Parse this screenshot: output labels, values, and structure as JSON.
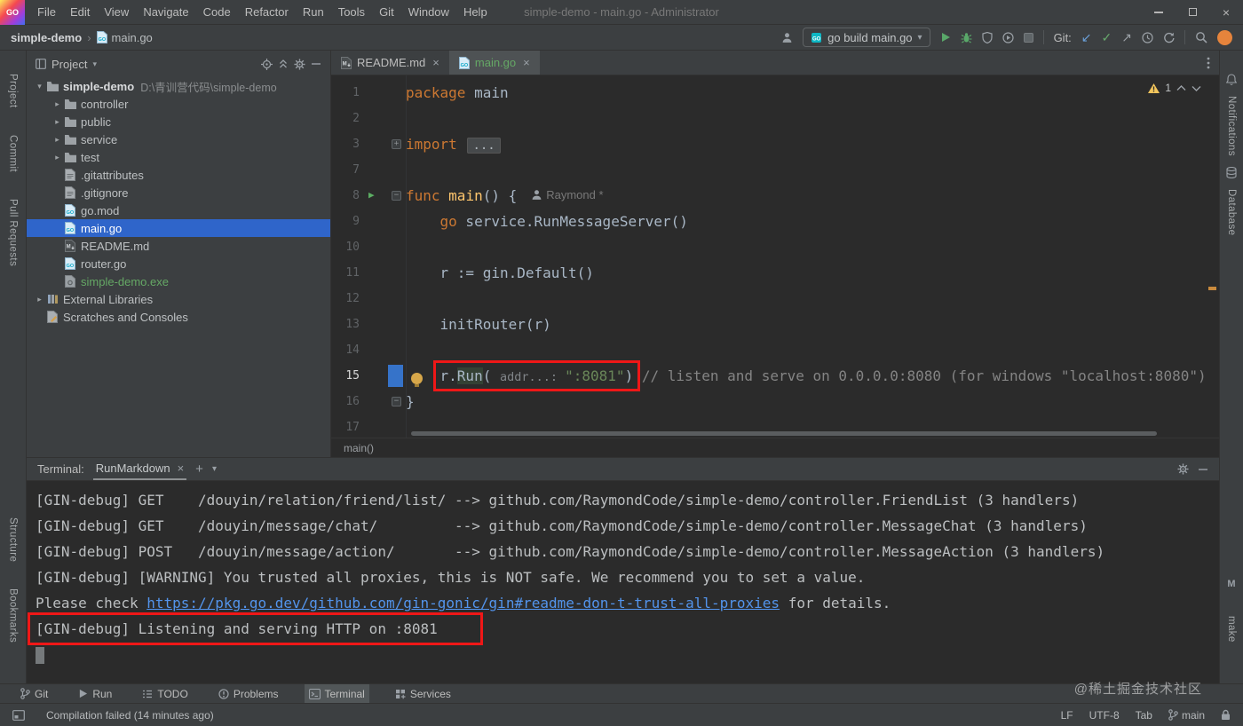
{
  "window": {
    "logo_text": "GO",
    "menus": [
      "File",
      "Edit",
      "View",
      "Navigate",
      "Code",
      "Refactor",
      "Run",
      "Tools",
      "Git",
      "Window",
      "Help"
    ],
    "title": "simple-demo - main.go - Administrator"
  },
  "nav": {
    "breadcrumb_root": "simple-demo",
    "breadcrumb_sep": "›",
    "breadcrumb_file": "main.go",
    "run_config": "go build main.go",
    "git_label": "Git:"
  },
  "stripes": {
    "left_top": [
      "Project",
      "Commit",
      "Pull Requests"
    ],
    "left_bottom": [
      "Structure",
      "Bookmarks"
    ],
    "right_top": [
      "Notifications",
      "Database"
    ],
    "right_bottom": [
      "make"
    ],
    "make_badge": "M"
  },
  "project": {
    "title": "Project",
    "tree": [
      {
        "label": "simple-demo",
        "hint": "D:\\青训营代码\\simple-demo",
        "icon": "folder",
        "indent": 0,
        "arrow": "down",
        "bold": true
      },
      {
        "label": "controller",
        "icon": "folder",
        "indent": 1,
        "arrow": "right"
      },
      {
        "label": "public",
        "icon": "folder",
        "indent": 1,
        "arrow": "right"
      },
      {
        "label": "service",
        "icon": "folder",
        "indent": 1,
        "arrow": "right"
      },
      {
        "label": "test",
        "icon": "folder",
        "indent": 1,
        "arrow": "right"
      },
      {
        "label": ".gitattributes",
        "icon": "file",
        "indent": 1
      },
      {
        "label": ".gitignore",
        "icon": "ignore",
        "indent": 1
      },
      {
        "label": "go.mod",
        "icon": "gomod",
        "indent": 1
      },
      {
        "label": "main.go",
        "icon": "go",
        "indent": 1,
        "selected": true
      },
      {
        "label": "README.md",
        "icon": "md",
        "indent": 1
      },
      {
        "label": "router.go",
        "icon": "go",
        "indent": 1
      },
      {
        "label": "simple-demo.exe",
        "icon": "exe",
        "indent": 1,
        "green": true
      },
      {
        "label": "External Libraries",
        "icon": "lib",
        "indent": 0,
        "arrow": "right"
      },
      {
        "label": "Scratches and Consoles",
        "icon": "scratch",
        "indent": 0
      }
    ]
  },
  "tabs": [
    {
      "label": "README.md",
      "icon": "mdpage",
      "active": false
    },
    {
      "label": "main.go",
      "icon": "gopage",
      "active": true
    }
  ],
  "editor": {
    "inspection_count": "1",
    "breadcrumb": "main()",
    "lines": [
      {
        "num": "1",
        "segs": [
          {
            "t": "package",
            "c": "kw"
          },
          {
            "t": " main",
            "c": "txt"
          }
        ]
      },
      {
        "num": "2",
        "segs": []
      },
      {
        "num": "3",
        "fold": "plus",
        "segs": [
          {
            "t": "import ",
            "c": "kw"
          },
          {
            "t": "...",
            "c": "fold"
          }
        ]
      },
      {
        "num": "7",
        "segs": []
      },
      {
        "num": "8",
        "run": true,
        "fold": "minus",
        "segs": [
          {
            "t": "func ",
            "c": "kw"
          },
          {
            "t": "main",
            "c": "fn"
          },
          {
            "t": "() {",
            "c": "txt"
          },
          {
            "t": "Raymond *",
            "c": "author"
          }
        ]
      },
      {
        "num": "9",
        "segs": [
          {
            "t": "    ",
            "c": "txt"
          },
          {
            "t": "go",
            "c": "kw"
          },
          {
            "t": " service.RunMessageServer()",
            "c": "txt"
          }
        ]
      },
      {
        "num": "10",
        "segs": []
      },
      {
        "num": "11",
        "segs": [
          {
            "t": "    r := gin.Default()",
            "c": "txt"
          }
        ]
      },
      {
        "num": "12",
        "segs": []
      },
      {
        "num": "13",
        "segs": [
          {
            "t": "    initRouter(r)",
            "c": "txt"
          }
        ]
      },
      {
        "num": "14",
        "segs": []
      },
      {
        "num": "15",
        "caret": true,
        "bulb": true,
        "segs": [
          {
            "t": "    ",
            "c": "txt"
          },
          {
            "t": "r.",
            "c": "txt",
            "box": true
          },
          {
            "t": "Run",
            "c": "hl",
            "box": true
          },
          {
            "t": "( ",
            "c": "txt",
            "box": true
          },
          {
            "t": "addr...: ",
            "c": "hint",
            "box": true
          },
          {
            "t": "\":8081\"",
            "c": "str",
            "box": true
          },
          {
            "t": ")",
            "c": "txt",
            "box": true
          },
          {
            "t": " // listen and serve on 0.0.0.0:8080 (for windows \"localhost:8080\")",
            "c": "cmt"
          }
        ]
      },
      {
        "num": "16",
        "fold": "minus",
        "segs": [
          {
            "t": "}",
            "c": "txt"
          }
        ]
      },
      {
        "num": "17",
        "segs": []
      }
    ]
  },
  "terminal": {
    "label": "Terminal:",
    "tab": "RunMarkdown",
    "lines": [
      {
        "segs": [
          {
            "t": "[GIN-debug] GET    /douyin/relation/friend/list/ --> github.com/RaymondCode/simple-demo/controller.FriendList (3 handlers)",
            "c": "t"
          }
        ]
      },
      {
        "segs": [
          {
            "t": "[GIN-debug] GET    /douyin/message/chat/         --> github.com/RaymondCode/simple-demo/controller.MessageChat (3 handlers)",
            "c": "t"
          }
        ]
      },
      {
        "segs": [
          {
            "t": "[GIN-debug] POST   /douyin/message/action/       --> github.com/RaymondCode/simple-demo/controller.MessageAction (3 handlers)",
            "c": "t"
          }
        ]
      },
      {
        "segs": [
          {
            "t": "[GIN-debug] [WARNING] You trusted all proxies, this is NOT safe. We recommend you to set a value.",
            "c": "t"
          }
        ]
      },
      {
        "segs": [
          {
            "t": "Please check ",
            "c": "t"
          },
          {
            "t": "https://pkg.go.dev/github.com/gin-gonic/gin#readme-don-t-trust-all-proxies",
            "c": "link"
          },
          {
            "t": " for details.",
            "c": "t"
          }
        ]
      },
      {
        "segs": [
          {
            "t": "[GIN-debug] Listening and serving HTTP on :8081",
            "c": "t",
            "box": true
          }
        ]
      },
      {
        "cursor": true,
        "segs": []
      }
    ]
  },
  "bottom_bar": [
    {
      "label": "Git",
      "icon": "branch"
    },
    {
      "label": "Run",
      "icon": "playgray"
    },
    {
      "label": "TODO",
      "icon": "todo"
    },
    {
      "label": "Problems",
      "icon": "problems"
    },
    {
      "label": "Terminal",
      "icon": "terminal",
      "active": true
    },
    {
      "label": "Services",
      "icon": "services"
    }
  ],
  "status": {
    "message": "Compilation failed (14 minutes ago)",
    "line_ending": "LF",
    "encoding": "UTF-8",
    "indent": "Tab",
    "branch": "main",
    "watermark": "@稀土掘金技术社区"
  }
}
